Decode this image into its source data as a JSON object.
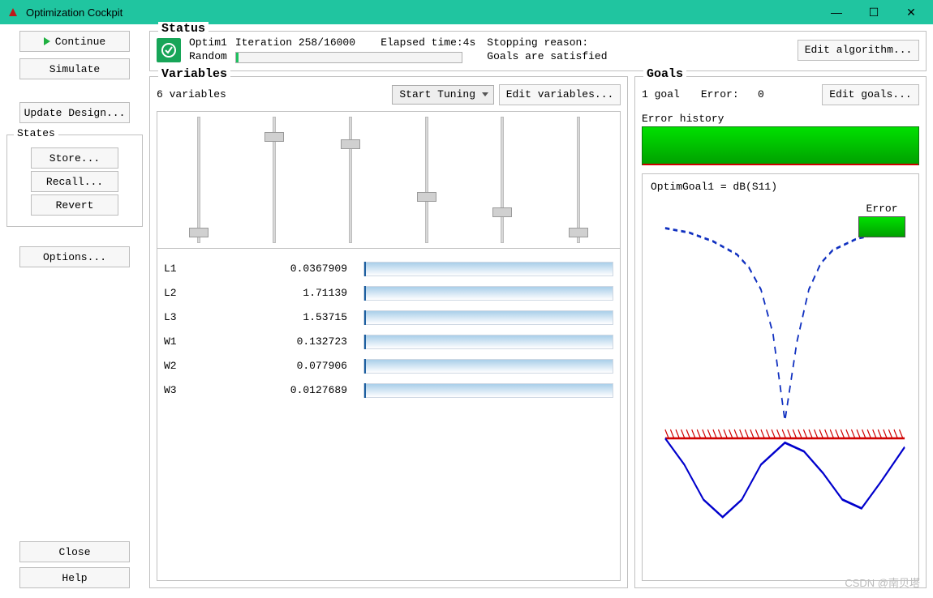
{
  "window": {
    "title": "Optimization Cockpit"
  },
  "left": {
    "continue": "Continue",
    "simulate": "Simulate",
    "update": "Update Design...",
    "states_legend": "States",
    "store": "Store...",
    "recall": "Recall...",
    "revert": "Revert",
    "options": "Options...",
    "close": "Close",
    "help": "Help"
  },
  "status": {
    "legend": "Status",
    "name": "Optim1",
    "method": "Random",
    "iteration": "Iteration 258/16000",
    "elapsed": "Elapsed time:4s",
    "stop_label": "Stopping reason:",
    "stop_reason": "Goals are satisfied",
    "edit_algo": "Edit algorithm..."
  },
  "variables": {
    "legend": "Variables",
    "count": "6 variables",
    "tuning": "Start Tuning",
    "edit": "Edit variables...",
    "rows": [
      {
        "name": "L1",
        "value": "0.0367909",
        "slider": 88
      },
      {
        "name": "L2",
        "value": "1.71139",
        "slider": 12
      },
      {
        "name": "L3",
        "value": "1.53715",
        "slider": 18
      },
      {
        "name": "W1",
        "value": "0.132723",
        "slider": 60
      },
      {
        "name": "W2",
        "value": "0.077906",
        "slider": 72
      },
      {
        "name": "W3",
        "value": "0.0127689",
        "slider": 88
      }
    ]
  },
  "goals": {
    "legend": "Goals",
    "count": "1 goal",
    "error_label": "Error:",
    "error_value": "0",
    "edit": "Edit goals...",
    "err_hist_label": "Error history",
    "plot_title": "OptimGoal1 = dB(S11)",
    "error_badge": "Error"
  },
  "chart_data": {
    "type": "line",
    "title": "OptimGoal1 = dB(S11)",
    "xlabel": "",
    "ylabel": "",
    "xlim": [
      0,
      1
    ],
    "ylim": [
      -40,
      0
    ],
    "series": [
      {
        "name": "dashed",
        "style": "dashed",
        "color": "#1030c0",
        "x": [
          0.0,
          0.1,
          0.2,
          0.3,
          0.35,
          0.4,
          0.45,
          0.5,
          0.55,
          0.6,
          0.65,
          0.7,
          0.8,
          0.9,
          1.0
        ],
        "y": [
          -2,
          -2.5,
          -3.5,
          -5,
          -6.5,
          -9,
          -14,
          -24,
          -15,
          -9,
          -6,
          -4.5,
          -3.2,
          -2.6,
          -2.2
        ]
      },
      {
        "name": "solid",
        "style": "solid",
        "color": "#0000cc",
        "x": [
          0.0,
          0.08,
          0.16,
          0.24,
          0.32,
          0.4,
          0.5,
          0.58,
          0.66,
          0.74,
          0.82,
          0.9,
          1.0
        ],
        "y": [
          -26,
          -29,
          -33,
          -35,
          -33,
          -29,
          -26.5,
          -27.5,
          -30,
          -33,
          -34,
          -31,
          -27
        ]
      }
    ],
    "threshold": {
      "y": -26,
      "color": "#d00000",
      "hatch": true
    }
  },
  "watermark": "CSDN @南贝塔"
}
